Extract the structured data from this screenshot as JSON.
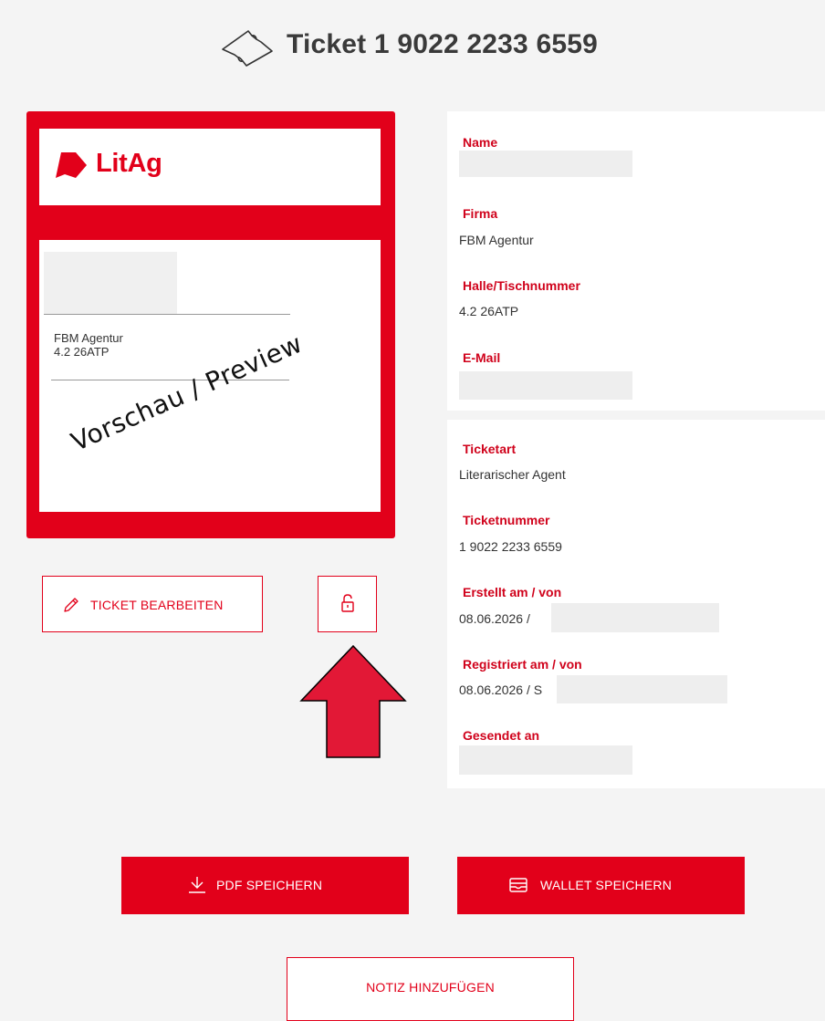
{
  "header": {
    "title": "Ticket 1 9022 2233 6559",
    "icon": "ticket-icon"
  },
  "preview": {
    "brand": "LitAg",
    "brand_color": "#e2001a",
    "company": "FBM Agentur",
    "table": "4.2 26ATP",
    "watermark": "Vorschau / Preview"
  },
  "actions": {
    "edit_label": "TICKET BEARBEITEN",
    "lock_icon": "unlock-icon",
    "pdf_label": "PDF SPEICHERN",
    "wallet_label": "WALLET SPEICHERN",
    "note_label": "NOTIZ HINZUFÜGEN"
  },
  "details": {
    "name_label": "Name",
    "company_label": "Firma",
    "company_value": "FBM Agentur",
    "table_label": "Halle/Tischnummer",
    "table_value": "4.2 26ATP",
    "email_label": "E-Mail",
    "type_label": "Ticketart",
    "type_value": "Literarischer Agent",
    "number_label": "Ticketnummer",
    "number_value": "1 9022 2233 6559",
    "created_label": "Erstellt am / von",
    "created_value": "08.06.2026 /",
    "registered_label": "Registriert am / von",
    "registered_value": "08.06.2026 / S",
    "sent_label": "Gesendet an"
  }
}
